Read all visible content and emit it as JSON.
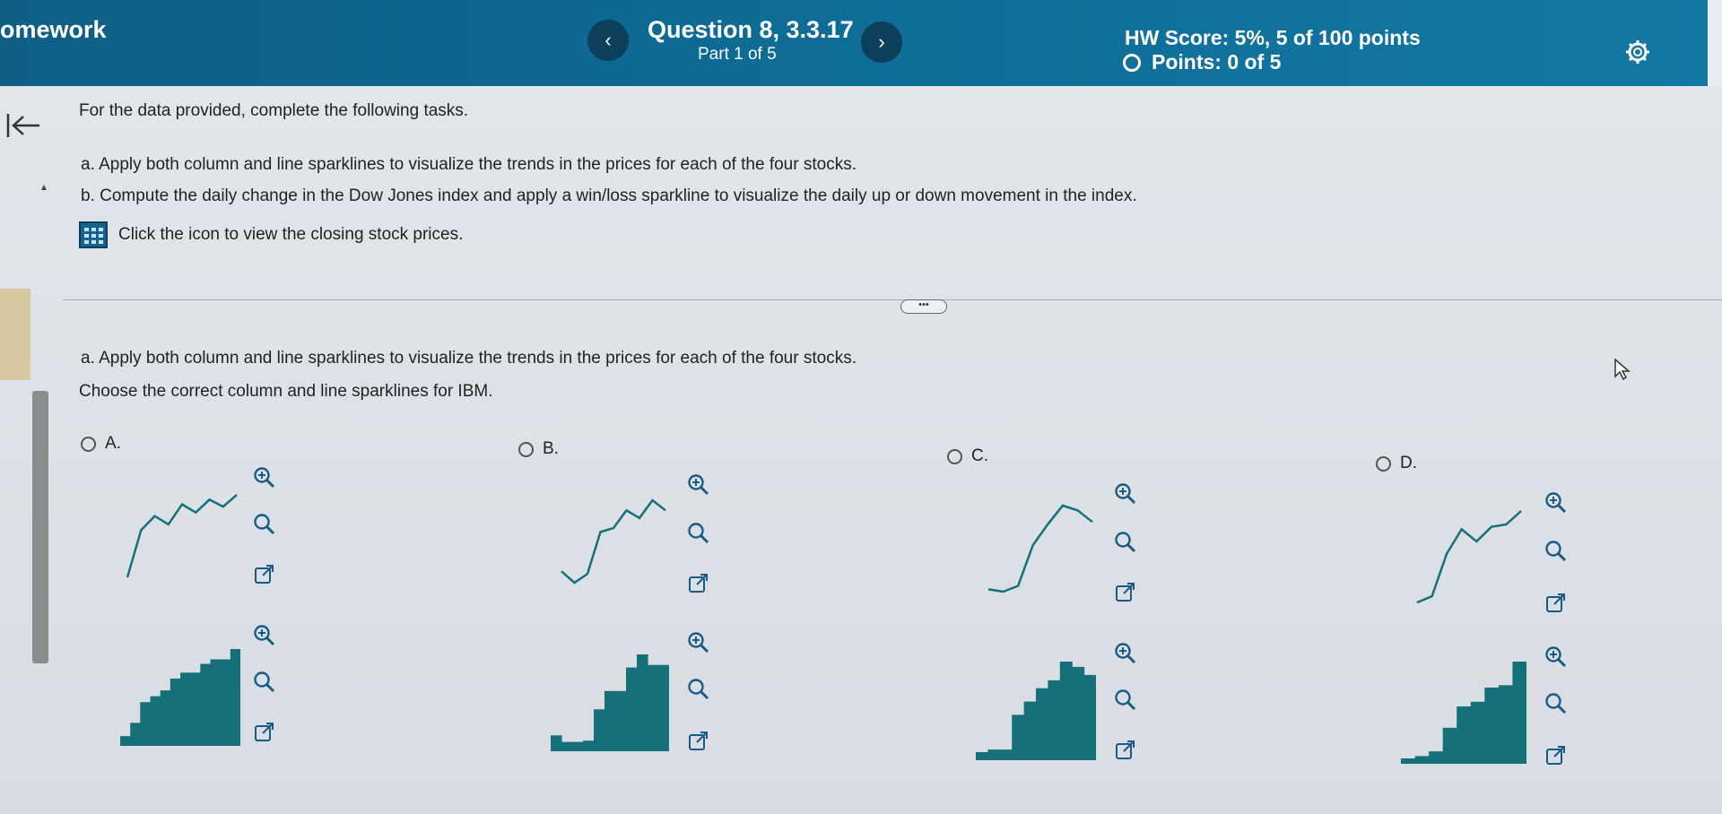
{
  "header": {
    "app_title": "omework",
    "question_title": "Question 8, 3.3.17",
    "question_part": "Part 1 of 5",
    "hw_score": "HW Score: 5%, 5 of 100 points",
    "points": "Points: 0 of 5",
    "prev_label": "‹",
    "next_label": "›"
  },
  "question": {
    "intro": "For the data provided, complete the following tasks.",
    "task_a": "a. Apply both column and line sparklines to visualize the trends in the prices for each of the four stocks.",
    "task_b": "b. Compute the daily change in the Dow Jones index and apply a win/loss sparkline to visualize the daily up or down movement in the index.",
    "data_link": "Click the icon to view the closing stock prices.",
    "more_label": "•••"
  },
  "part_a": {
    "heading": "a. Apply both column and line sparklines to visualize the trends in the prices for each of the four stocks.",
    "prompt": "Choose the correct column and line sparklines for IBM."
  },
  "choices": [
    {
      "label": "A.",
      "line": [
        0,
        40,
        52,
        45,
        62,
        55,
        66,
        60,
        70
      ],
      "columns": [
        3,
        12,
        26,
        30,
        34,
        42,
        46,
        46,
        52,
        55,
        55,
        62
      ]
    },
    {
      "label": "B.",
      "line": [
        14,
        5,
        12,
        45,
        48,
        62,
        56,
        70,
        62
      ],
      "columns": [
        8,
        3,
        3,
        4,
        28,
        42,
        42,
        60,
        70,
        62,
        62
      ]
    },
    {
      "label": "C.",
      "line": [
        2,
        0,
        5,
        40,
        58,
        74,
        70,
        60
      ],
      "columns": [
        2,
        4,
        4,
        30,
        40,
        50,
        56,
        70,
        66,
        60
      ]
    },
    {
      "label": "D.",
      "line": [
        0,
        5,
        40,
        60,
        50,
        62,
        64,
        75
      ],
      "columns": [
        0,
        2,
        6,
        26,
        44,
        48,
        60,
        62,
        82
      ]
    }
  ],
  "colors": {
    "header_bg": "#0e6d97",
    "sparkline": "#16707a",
    "nav_btn": "#0c3f59",
    "icon": "#1a5b86"
  },
  "icons": [
    "zoom-in-icon",
    "zoom-out-icon",
    "popout-icon",
    "settings-gear-icon",
    "back-arrow-icon",
    "table-grid-icon"
  ]
}
